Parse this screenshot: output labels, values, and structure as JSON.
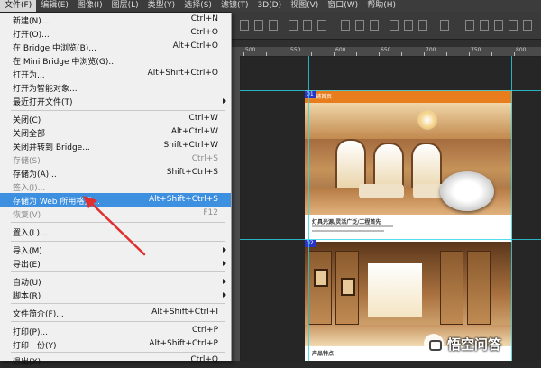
{
  "menubar": {
    "items": [
      {
        "label": "文件(F)"
      },
      {
        "label": "编辑(E)"
      },
      {
        "label": "图像(I)"
      },
      {
        "label": "图层(L)"
      },
      {
        "label": "类型(Y)"
      },
      {
        "label": "选择(S)"
      },
      {
        "label": "滤镜(T)"
      },
      {
        "label": "3D(D)"
      },
      {
        "label": "视图(V)"
      },
      {
        "label": "窗口(W)"
      },
      {
        "label": "帮助(H)"
      }
    ]
  },
  "file_menu": {
    "items": [
      {
        "label": "新建(N)...",
        "shortcut": "Ctrl+N"
      },
      {
        "label": "打开(O)...",
        "shortcut": "Ctrl+O"
      },
      {
        "label": "在 Bridge 中浏览(B)...",
        "shortcut": "Alt+Ctrl+O"
      },
      {
        "label": "在 Mini Bridge 中浏览(G)...",
        "shortcut": ""
      },
      {
        "label": "打开为...",
        "shortcut": "Alt+Shift+Ctrl+O"
      },
      {
        "label": "打开为智能对象...",
        "shortcut": ""
      },
      {
        "label": "最近打开文件(T)",
        "shortcut": ""
      },
      {
        "label": "关闭(C)",
        "shortcut": "Ctrl+W"
      },
      {
        "label": "关闭全部",
        "shortcut": "Alt+Ctrl+W"
      },
      {
        "label": "关闭并转到 Bridge...",
        "shortcut": "Shift+Ctrl+W"
      },
      {
        "label": "存储(S)",
        "shortcut": "Ctrl+S"
      },
      {
        "label": "存储为(A)...",
        "shortcut": "Shift+Ctrl+S"
      },
      {
        "label": "签入(I)...",
        "shortcut": ""
      },
      {
        "label": "存储为 Web 所用格式...",
        "shortcut": "Alt+Shift+Ctrl+S"
      },
      {
        "label": "恢复(V)",
        "shortcut": "F12"
      },
      {
        "label": "置入(L)...",
        "shortcut": ""
      },
      {
        "label": "导入(M)",
        "shortcut": ""
      },
      {
        "label": "导出(E)",
        "shortcut": ""
      },
      {
        "label": "自动(U)",
        "shortcut": ""
      },
      {
        "label": "脚本(R)",
        "shortcut": ""
      },
      {
        "label": "文件简介(F)...",
        "shortcut": "Alt+Shift+Ctrl+I"
      },
      {
        "label": "打印(P)...",
        "shortcut": "Ctrl+P"
      },
      {
        "label": "打印一份(Y)",
        "shortcut": "Alt+Shift+Ctrl+P"
      },
      {
        "label": "退出(X)",
        "shortcut": "Ctrl+Q"
      }
    ]
  },
  "canvas": {
    "slice1_badge": "01",
    "slice2_badge": "02",
    "header_label": "店铺首页",
    "caption1": "灯具光源/灵活广泛/工程首先",
    "caption2": "产品特点："
  },
  "ruler": {
    "labels": [
      "500",
      "550",
      "600",
      "650",
      "700",
      "750",
      "800"
    ]
  },
  "watermark": {
    "text": "悟空问答"
  },
  "colors": {
    "highlight": "#3d8fe0",
    "annotation_arrow": "#e03030",
    "guide": "#2ad3e8",
    "slice_badge": "#2a35c7",
    "accent_orange": "#e87d1e"
  }
}
